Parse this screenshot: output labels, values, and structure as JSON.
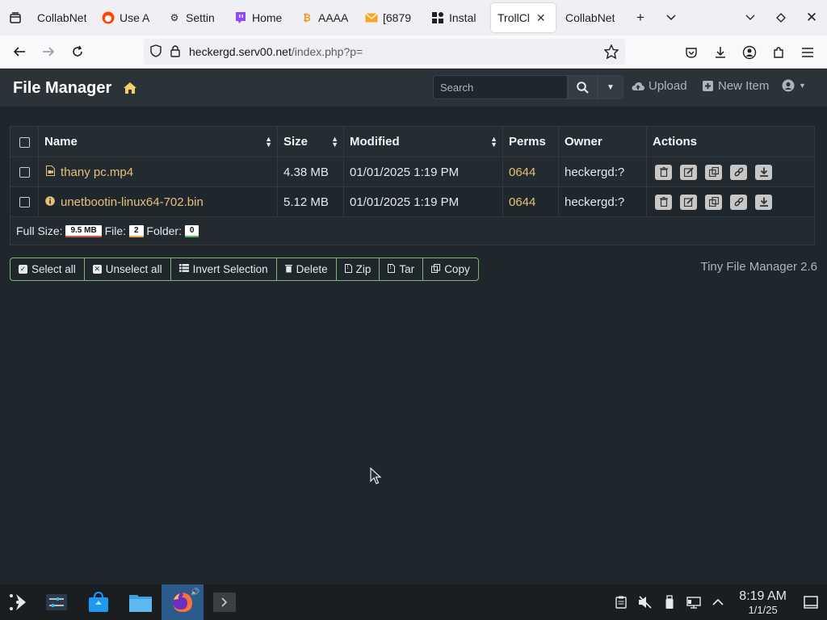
{
  "browser": {
    "tabs": [
      {
        "label": "CollabNet",
        "icon": "none"
      },
      {
        "label": "Use A",
        "icon": "reddit-icon"
      },
      {
        "label": "Settin",
        "icon": "gear-icon"
      },
      {
        "label": "Home",
        "icon": "twitch-icon"
      },
      {
        "label": "AAAA",
        "icon": "bitcoin-icon"
      },
      {
        "label": "[6879",
        "icon": "mail-icon"
      },
      {
        "label": "Instal",
        "icon": "extension-icon"
      },
      {
        "label": "TrollCl",
        "icon": "none"
      },
      {
        "label": "CollabNet",
        "icon": "none"
      }
    ],
    "active_tab_index": 7,
    "url_host": "heckergd.serv00.net",
    "url_path": "/index.php?p="
  },
  "app": {
    "title": "File Manager",
    "search_placeholder": "Search",
    "upload_label": "Upload",
    "new_item_label": "New Item"
  },
  "table": {
    "headers": {
      "name": "Name",
      "size": "Size",
      "modified": "Modified",
      "perms": "Perms",
      "owner": "Owner",
      "actions": "Actions"
    },
    "rows": [
      {
        "name": "thany pc.mp4",
        "size": "4.38 MB",
        "modified": "01/01/2025 1:19 PM",
        "perms": "0644",
        "owner": "heckergd:?"
      },
      {
        "name": "unetbootin-linux64-702.bin",
        "size": "5.12 MB",
        "modified": "01/01/2025 1:19 PM",
        "perms": "0644",
        "owner": "heckergd:?"
      }
    ],
    "footer": {
      "full_size_label": "Full Size:",
      "full_size_value": "9.5 MB",
      "file_label": "File:",
      "file_count": "2",
      "folder_label": "Folder:",
      "folder_count": "0"
    }
  },
  "bulk_actions": {
    "select_all": "Select all",
    "unselect_all": "Unselect all",
    "invert_selection": "Invert Selection",
    "delete": "Delete",
    "zip": "Zip",
    "tar": "Tar",
    "copy": "Copy"
  },
  "version": "Tiny File Manager 2.6",
  "taskbar": {
    "time": "8:19 AM",
    "date": "1/1/25"
  },
  "colors": {
    "accent_link": "#e5c07b",
    "background": "#1f262c",
    "header": "#2b3238",
    "taskbar_active": "#2c5a8a"
  }
}
